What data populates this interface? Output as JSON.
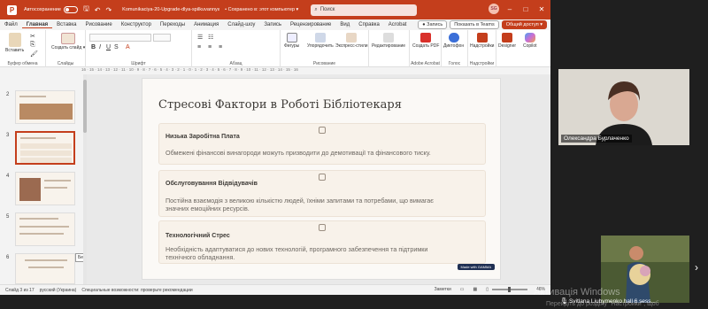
{
  "titlebar": {
    "app_letter": "P",
    "autosave_label": "Автосохранение",
    "file_name": "Komunikaciya-20-Upgrade-dlya-spilkuvannya-bez-str...",
    "saved_status": "• Сохранено в: этот компьютер ▾",
    "search_placeholder": "Поиск",
    "avatar_initials": "SG"
  },
  "menu": {
    "items": [
      "Файл",
      "Главная",
      "Вставка",
      "Рисование",
      "Конструктор",
      "Переходы",
      "Анимация",
      "Слайд-шоу",
      "Запись",
      "Рецензирование",
      "Вид",
      "Справка",
      "Acrobat"
    ],
    "active": "Главная",
    "record_label": "● Запись",
    "teams_label": "Показать в Teams",
    "share_label": "Общий доступ ▾"
  },
  "ribbon": {
    "paste_label": "Вставить",
    "create_slide_label": "Создать слайд ▾",
    "clipboard_label": "Буфер обмена",
    "slides_label": "Слайды",
    "font_label": "Шрифт",
    "paragraph_label": "Абзац",
    "shapes_label": "Фигуры",
    "arrange_label": "Упорядочить",
    "styles_label": "Экспресс-стили",
    "drawing_label": "Рисование",
    "editing_label": "Редактирование",
    "pdf_label": "Создать PDF",
    "acrobat_label": "Adobe Acrobat",
    "dictate_label": "Диктофон",
    "voice_label": "Голос",
    "addins_label": "Надстройки",
    "addins_group": "Надстройки",
    "designer_label": "Designer",
    "copilot_label": "Copilot"
  },
  "ruler_text": "16 · 15 · 14 · 13 · 12 · 11 · 10 · 9 · 8 · 7 · 6 · 5 · 4 · 3 · 2 · 1 · 0 · 1 · 2 · 3 · 4 · 5 · 6 · 7 · 8 · 9 · 10 · 11 · 12 · 13 · 14 · 15 · 16",
  "thumbnails": [
    "2",
    "3",
    "4",
    "5",
    "6"
  ],
  "tooltip": "Без заголовка",
  "slide": {
    "title": "Стресові Фактори в Роботі Бібліотекаря",
    "cards": [
      {
        "heading": "Низька Заробітна Плата",
        "text": "Обмежені фінансові винагороди можуть призводити до демотивації та фінансового тиску."
      },
      {
        "heading": "Обслуговування Відвідувачів",
        "text_line1": "Постійна взаємодія з великою кількістю людей, їхніми запитами та потребами, що вимагає",
        "text_line2": "значних емоційних ресурсів."
      },
      {
        "heading": "Технологічний Стрес",
        "text_line1": "Необхідність адаптуватися до нових технологій, програмного забезпечення та підтримки",
        "text_line2": "технічного обладнання."
      }
    ],
    "made_with": "Made with GAMMA"
  },
  "status": {
    "slide_counter": "Слайд 3 из 17",
    "language": "русский (Украина)",
    "accessibility": "Специальные возможности: проверьте рекомендации",
    "notes": "Заметки",
    "zoom": "46%"
  },
  "participants": {
    "main_name": "Олександра Бурлаченко",
    "small_name": "Svitlana Liubymenko hall 6 sess..."
  },
  "watermark": {
    "line1": "Активація Windows",
    "line2": "Перейдіть до розділу \"Настройки\", щоб"
  }
}
